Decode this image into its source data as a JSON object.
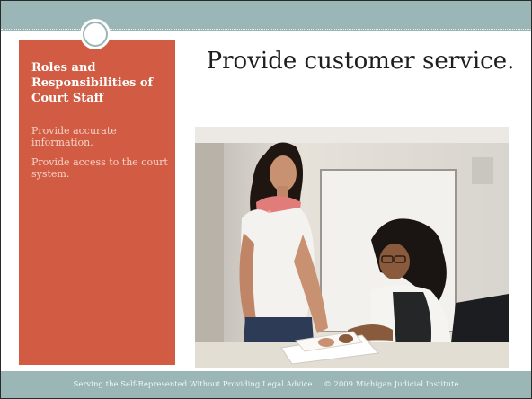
{
  "sidebar": {
    "title": "Roles and Responsibilities of Court Staff",
    "items": [
      {
        "label": "Provide accurate information."
      },
      {
        "label": "Provide access to the court system."
      }
    ]
  },
  "main": {
    "title": "Provide customer service."
  },
  "footer": {
    "text": "Serving the Self-Represented Without Providing Legal Advice",
    "copyright": "© 2009 Michigan Judicial Institute"
  },
  "colors": {
    "band": "#9ab6b6",
    "sidebar": "#d15c43",
    "sidebar_text_muted": "#f6d2c7"
  }
}
